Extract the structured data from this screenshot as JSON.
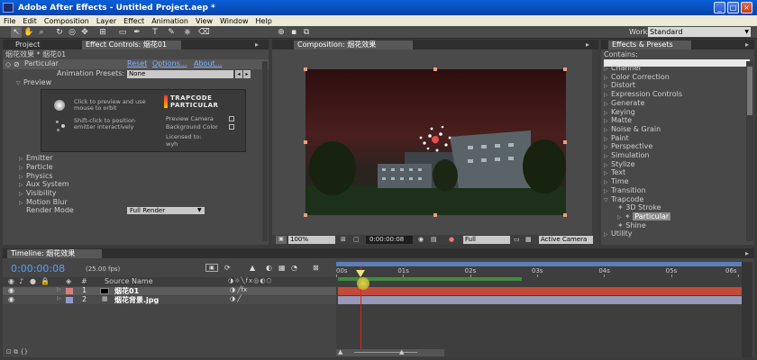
{
  "window": {
    "title": "Adobe After Effects - Untitled Project.aep *",
    "min_glyph": "_",
    "max_glyph": "□",
    "close_glyph": "×"
  },
  "menu": [
    "File",
    "Edit",
    "Composition",
    "Layer",
    "Effect",
    "Animation",
    "View",
    "Window",
    "Help"
  ],
  "workspace": {
    "label": "Workspace:",
    "value": "Standard"
  },
  "project_panel": {
    "tabs": [
      "Project",
      "Effect Controls: 烟花01"
    ],
    "breadcrumb": "烟花效果 * 烟花01",
    "effect_name": "Particular",
    "reset": "Reset",
    "options": "Options...",
    "about": "About...",
    "presets_label": "Animation Presets:",
    "presets_value": "None",
    "preview_label": "Preview",
    "preview_hint1": "Click to preview and use mouse to orbit",
    "preview_hint2": "Shift-click to position emitter interactively",
    "logo_line1": "TRAPCODE",
    "logo_line2": "PARTICULAR",
    "preview_camera": "Preview Camera",
    "background_color": "Background Color",
    "licensed_to": "Licensed to:",
    "licensee": "wyh",
    "groups": [
      "Emitter",
      "Particle",
      "Physics",
      "Aux System",
      "Visibility",
      "Motion Blur"
    ],
    "render_mode_label": "Render Mode",
    "render_mode_value": "Full Render"
  },
  "comp_panel": {
    "tab": "Composition: 烟花效果",
    "zoom": "100%",
    "timecode": "0:00:00:08",
    "resolution": "Full",
    "camera": "Active Camera"
  },
  "effects_panel": {
    "tab": "Effects & Presets",
    "contains_label": "Contains:",
    "categories": [
      "Channel",
      "Color Correction",
      "Distort",
      "Expression Controls",
      "Generate",
      "Keying",
      "Matte",
      "Noise & Grain",
      "Paint",
      "Perspective",
      "Simulation",
      "Stylize",
      "Text",
      "Time",
      "Transition",
      "Trapcode"
    ],
    "trapcode_items": [
      "3D Stroke",
      "Particular",
      "Shine"
    ],
    "last_category": "Utility"
  },
  "timeline": {
    "tab": "Timeline: 烟花效果",
    "timecode": "0:00:00:08",
    "fps": "(25.00 fps)",
    "column_hash": "#",
    "column_source": "Source Name",
    "ruler_labels": [
      "00s",
      "01s",
      "02s",
      "03s",
      "04s",
      "05s",
      "06s"
    ],
    "layers": [
      {
        "num": "1",
        "name": "烟花01",
        "bar_color": "#c14a3a"
      },
      {
        "num": "2",
        "name": "烟花背景.jpg",
        "bar_color": "#9898b8"
      }
    ]
  },
  "colors": {
    "accent_blue": "#0a5fd8",
    "timecode_blue": "#5a9cff",
    "playhead": "#e02020"
  }
}
